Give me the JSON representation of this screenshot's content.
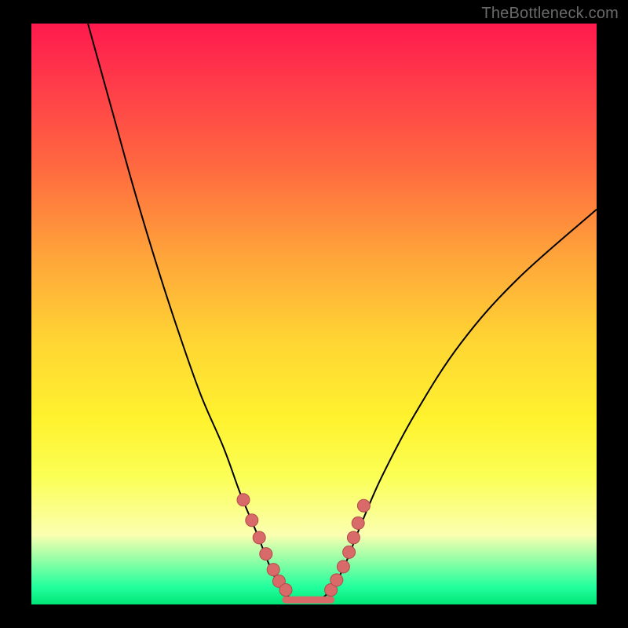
{
  "watermark": "TheBottleneck.com",
  "colors": {
    "dot_fill": "#d96a6a",
    "dot_stroke": "#b24a4a",
    "curve": "#000000"
  },
  "chart_data": {
    "type": "line",
    "title": "",
    "xlabel": "",
    "ylabel": "",
    "xlim": [
      0,
      100
    ],
    "ylim": [
      0,
      100
    ],
    "note": "Approximate V-shaped bottleneck valley. x/y are percentages of the plot area; y=0 is the top, y=100 is the bottom (matching visual layout). Curve descends from top-left, reaches a flat minimum near x≈44–52, then rises to the right edge.",
    "series": [
      {
        "name": "bottleneck-curve",
        "x": [
          10,
          14,
          18,
          22,
          26,
          30,
          34,
          37,
          40,
          42,
          44,
          46,
          48,
          50,
          52,
          54,
          56,
          58,
          62,
          68,
          76,
          86,
          100
        ],
        "y": [
          0,
          14,
          28,
          41,
          53,
          64,
          73,
          81,
          88,
          93,
          97,
          99,
          99.5,
          99.5,
          98.5,
          96,
          92,
          87,
          78,
          67,
          55,
          44,
          32
        ]
      }
    ],
    "markers": {
      "name": "highlighted-points",
      "note": "Salmon dots clustered on both slopes near the valley.",
      "x": [
        37.5,
        39.0,
        40.3,
        41.5,
        42.8,
        43.8,
        45.0,
        53.0,
        54.0,
        55.2,
        56.2,
        57.0,
        57.8,
        58.8
      ],
      "y": [
        82.0,
        85.5,
        88.5,
        91.3,
        94.0,
        96.0,
        97.5,
        97.5,
        95.8,
        93.5,
        91.0,
        88.5,
        86.0,
        83.0
      ]
    },
    "flat_segment": {
      "x_start": 45.0,
      "x_end": 53.0,
      "y": 99.2
    }
  }
}
